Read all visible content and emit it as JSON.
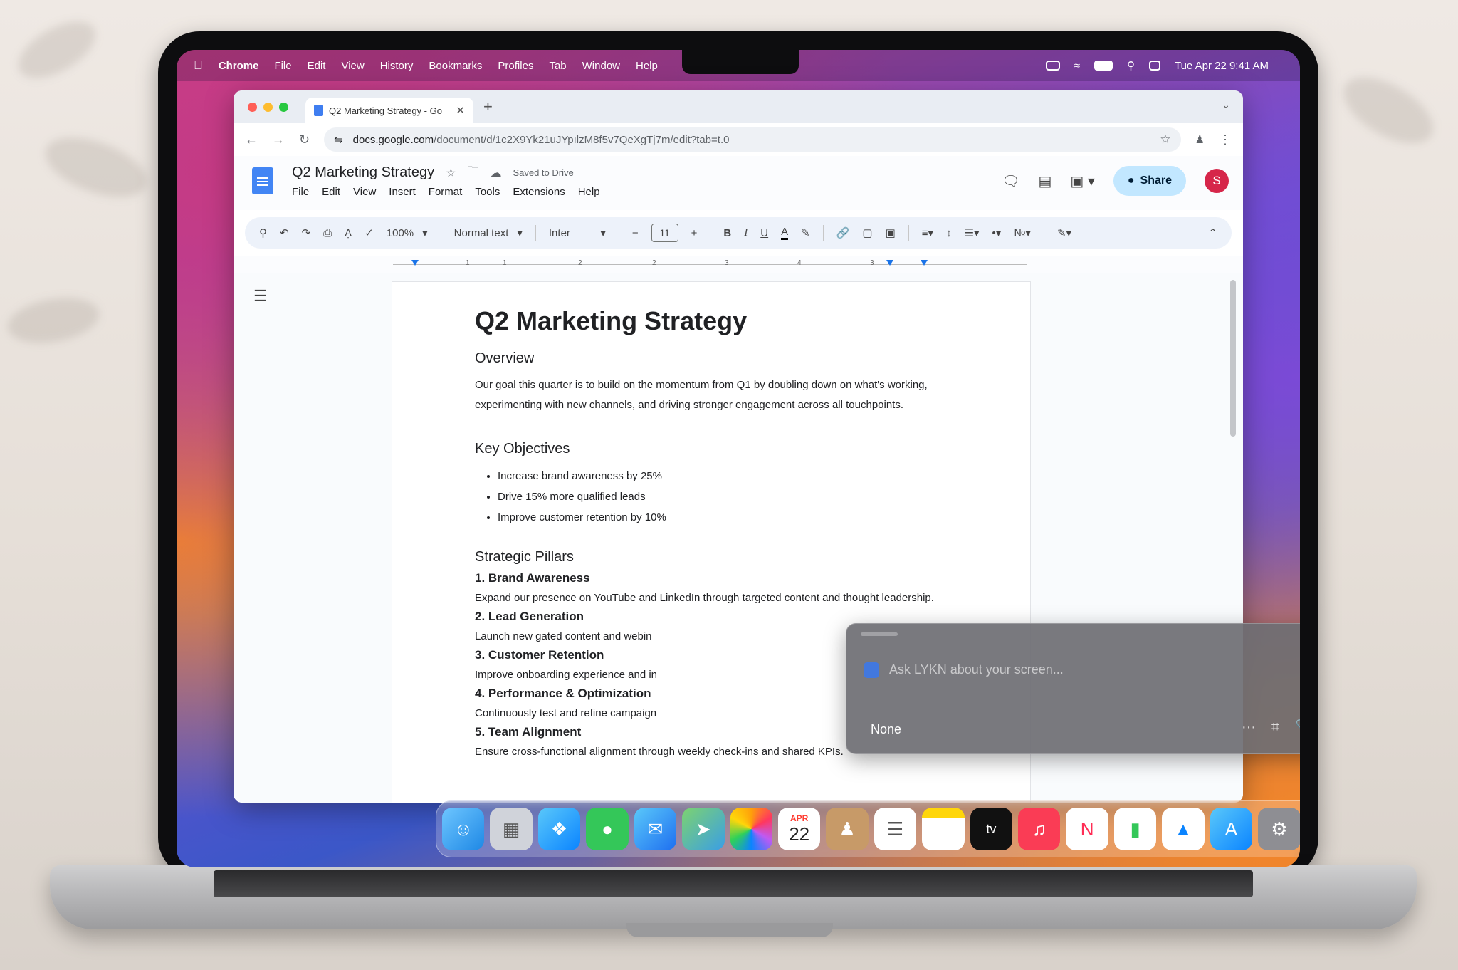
{
  "menubar": {
    "app": "Chrome",
    "items": [
      "File",
      "Edit",
      "View",
      "History",
      "Bookmarks",
      "Profiles",
      "Tab",
      "Window",
      "Help"
    ],
    "clock": "Tue Apr 22  9:41 AM"
  },
  "browser": {
    "tab_title": "Q2 Marketing Strategy - Go",
    "url_host": "docs.google.com",
    "url_path": "/document/d/1c2X9Yk21uJYpılzM8f5v7QeXgTj7m/edit?tab=t.0"
  },
  "docs": {
    "title": "Q2 Marketing Strategy",
    "saved_status": "Saved to Drive",
    "menu": [
      "File",
      "Edit",
      "View",
      "Insert",
      "Format",
      "Tools",
      "Extensions",
      "Help"
    ],
    "share_label": "Share",
    "avatar_initial": "S",
    "toolbar": {
      "zoom": "100%",
      "style": "Normal text",
      "font": "Inter",
      "font_size": "11"
    },
    "ruler_marks": [
      "1",
      "1",
      "2",
      "2",
      "3",
      "4",
      "3"
    ]
  },
  "document": {
    "heading": "Q2 Marketing Strategy",
    "overview_heading": "Overview",
    "overview_line1": "Our goal this quarter is to build on the momentum from Q1 by doubling down on what's working,",
    "overview_line2": "experimenting with new channels, and driving stronger engagement across all touchpoints.",
    "objectives_heading": "Key Objectives",
    "objectives": [
      "Increase brand awareness by 25%",
      "Drive 15% more qualified leads",
      "Improve customer retention by 10%"
    ],
    "pillars_heading": "Strategic Pillars",
    "pillars": [
      {
        "title": "1. Brand Awareness",
        "text": "Expand our presence on YouTube and LinkedIn through targeted content and thought leadership."
      },
      {
        "title": "2. Lead Generation",
        "text": "Launch new gated content and webin"
      },
      {
        "title": "3. Customer Retention",
        "text": "Improve onboarding experience and in"
      },
      {
        "title": "4. Performance & Optimization",
        "text": "Continuously test and refine campaign"
      },
      {
        "title": "5. Team Alignment",
        "text": "Ensure cross-functional alignment through weekly check-ins and shared KPIs."
      }
    ]
  },
  "assistant": {
    "placeholder": "Ask LYKN about your screen...",
    "model": "None",
    "more": "···"
  },
  "dock": {
    "calendar_month": "APR",
    "calendar_day": "22",
    "tv_label": "tv"
  }
}
